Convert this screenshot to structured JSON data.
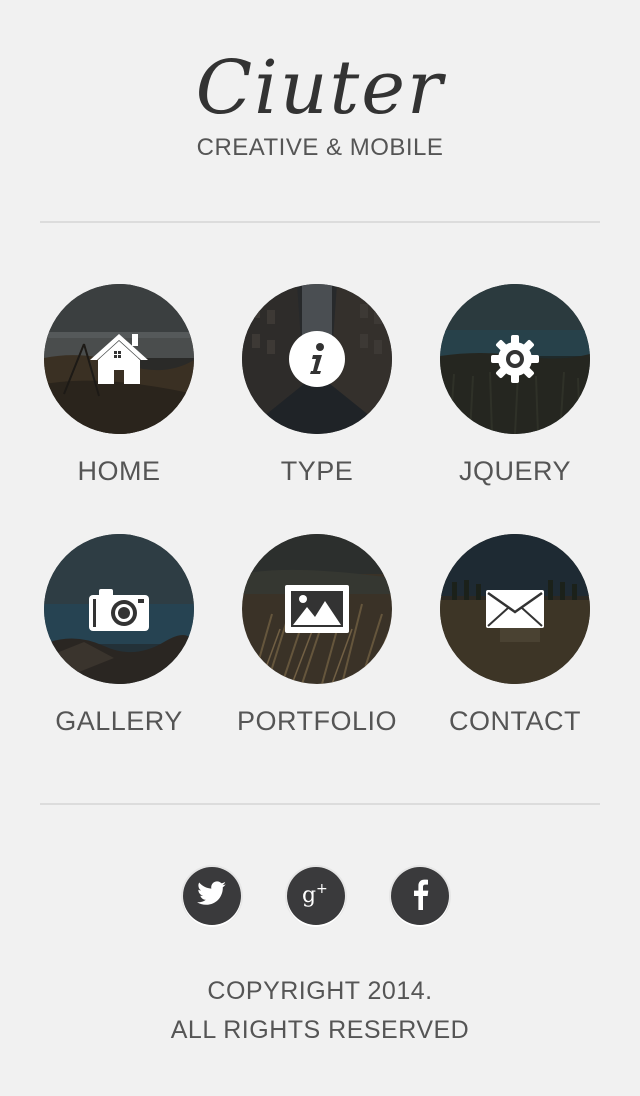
{
  "header": {
    "logo": "Ciuter",
    "tagline": "CREATIVE & MOBILE"
  },
  "menu": [
    {
      "label": "HOME",
      "icon": "home-icon"
    },
    {
      "label": "TYPE",
      "icon": "info-icon"
    },
    {
      "label": "JQUERY",
      "icon": "gear-icon"
    },
    {
      "label": "GALLERY",
      "icon": "camera-icon"
    },
    {
      "label": "PORTFOLIO",
      "icon": "image-icon"
    },
    {
      "label": "CONTACT",
      "icon": "envelope-icon"
    }
  ],
  "social": [
    {
      "icon": "twitter-icon"
    },
    {
      "icon": "google-plus-icon"
    },
    {
      "icon": "facebook-icon"
    }
  ],
  "footer": {
    "line1": "COPYRIGHT 2014.",
    "line2": "ALL RIGHTS RESERVED"
  },
  "colors": {
    "background": "#f1f1f1",
    "text": "#555555",
    "social": "#3a3a3c"
  }
}
